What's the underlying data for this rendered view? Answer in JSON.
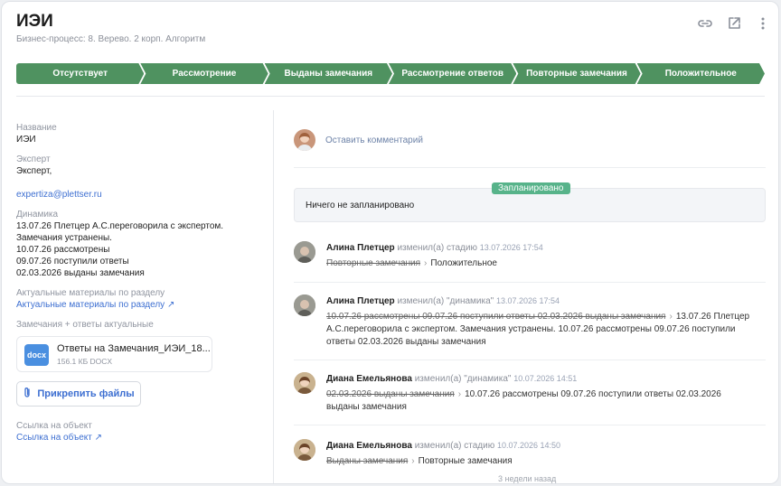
{
  "header": {
    "title": "ИЭИ",
    "subtitle": "Бизнес-процесс: 8. Верево. 2 корп. Алгоритм"
  },
  "toolbar": {
    "icons": [
      "link-icon",
      "open-external-icon",
      "more-vertical-icon"
    ]
  },
  "stages": [
    "Отсутствует",
    "Рассмотрение",
    "Выданы замечания",
    "Рассмотрение ответов",
    "Повторные замечания",
    "Положительное"
  ],
  "colors": {
    "stage": "#4f9260",
    "link": "#3d6fd1",
    "badge": "#57b38a"
  },
  "details": {
    "name_label": "Название",
    "name_value": "ИЭИ",
    "expert_label": "Эксперт",
    "expert_value": "Эксперт,",
    "expert_email": "expertiza@plettser.ru",
    "dynamics_label": "Динамика",
    "dynamics_lines": [
      "13.07.26 Плетцер А.С.переговорила с экспертом.",
      "Замечания устранены.",
      "10.07.26 рассмотрены",
      "09.07.26 поступили ответы",
      "02.03.2026 выданы замечания"
    ],
    "materials_label": "Актуальные материалы по разделу",
    "materials_link": "Актуальные материалы по разделу",
    "remarks_label": "Замечания + ответы актуальные",
    "file": {
      "type": "docx",
      "name": "Ответы на Замечания_ИЭИ_18...",
      "meta": "156.1 КБ DOCX"
    },
    "attach_label": "Прикрепить файлы",
    "object_link_label": "Ссылка на объект",
    "object_link": "Ссылка на объект"
  },
  "activity": {
    "comment_placeholder": "Оставить комментарий",
    "planned_badge": "Запланировано",
    "planned_text": "Ничего не запланировано",
    "events": [
      {
        "author": "Алина Плетцер",
        "action": "изменил(а) стадию",
        "time": "13.07.2026 17:54",
        "old": "Повторные замечания",
        "new": "Положительное"
      },
      {
        "author": "Алина Плетцер",
        "action": "изменил(а) \"динамика\"",
        "time": "13.07.2026 17:54",
        "old": "10.07.26 рассмотрены 09.07.26 поступили ответы 02.03.2026 выданы замечания",
        "new": "13.07.26 Плетцер А.С.переговорила с экспертом. Замечания устранены. 10.07.26 рассмотрены 09.07.26 поступили ответы 02.03.2026 выданы замечания"
      },
      {
        "author": "Диана Емельянова",
        "action": "изменил(а) \"динамика\"",
        "time": "10.07.2026 14:51",
        "old": "02.03.2026 выданы замечания",
        "new": "10.07.26 рассмотрены 09.07.26 поступили ответы 02.03.2026 выданы замечания"
      },
      {
        "author": "Диана Емельянова",
        "action": "изменил(а) стадию",
        "time": "10.07.2026 14:50",
        "old": "Выданы замечания",
        "new": "Повторные замечания"
      }
    ],
    "weeks_ago": "3 недели назад"
  }
}
